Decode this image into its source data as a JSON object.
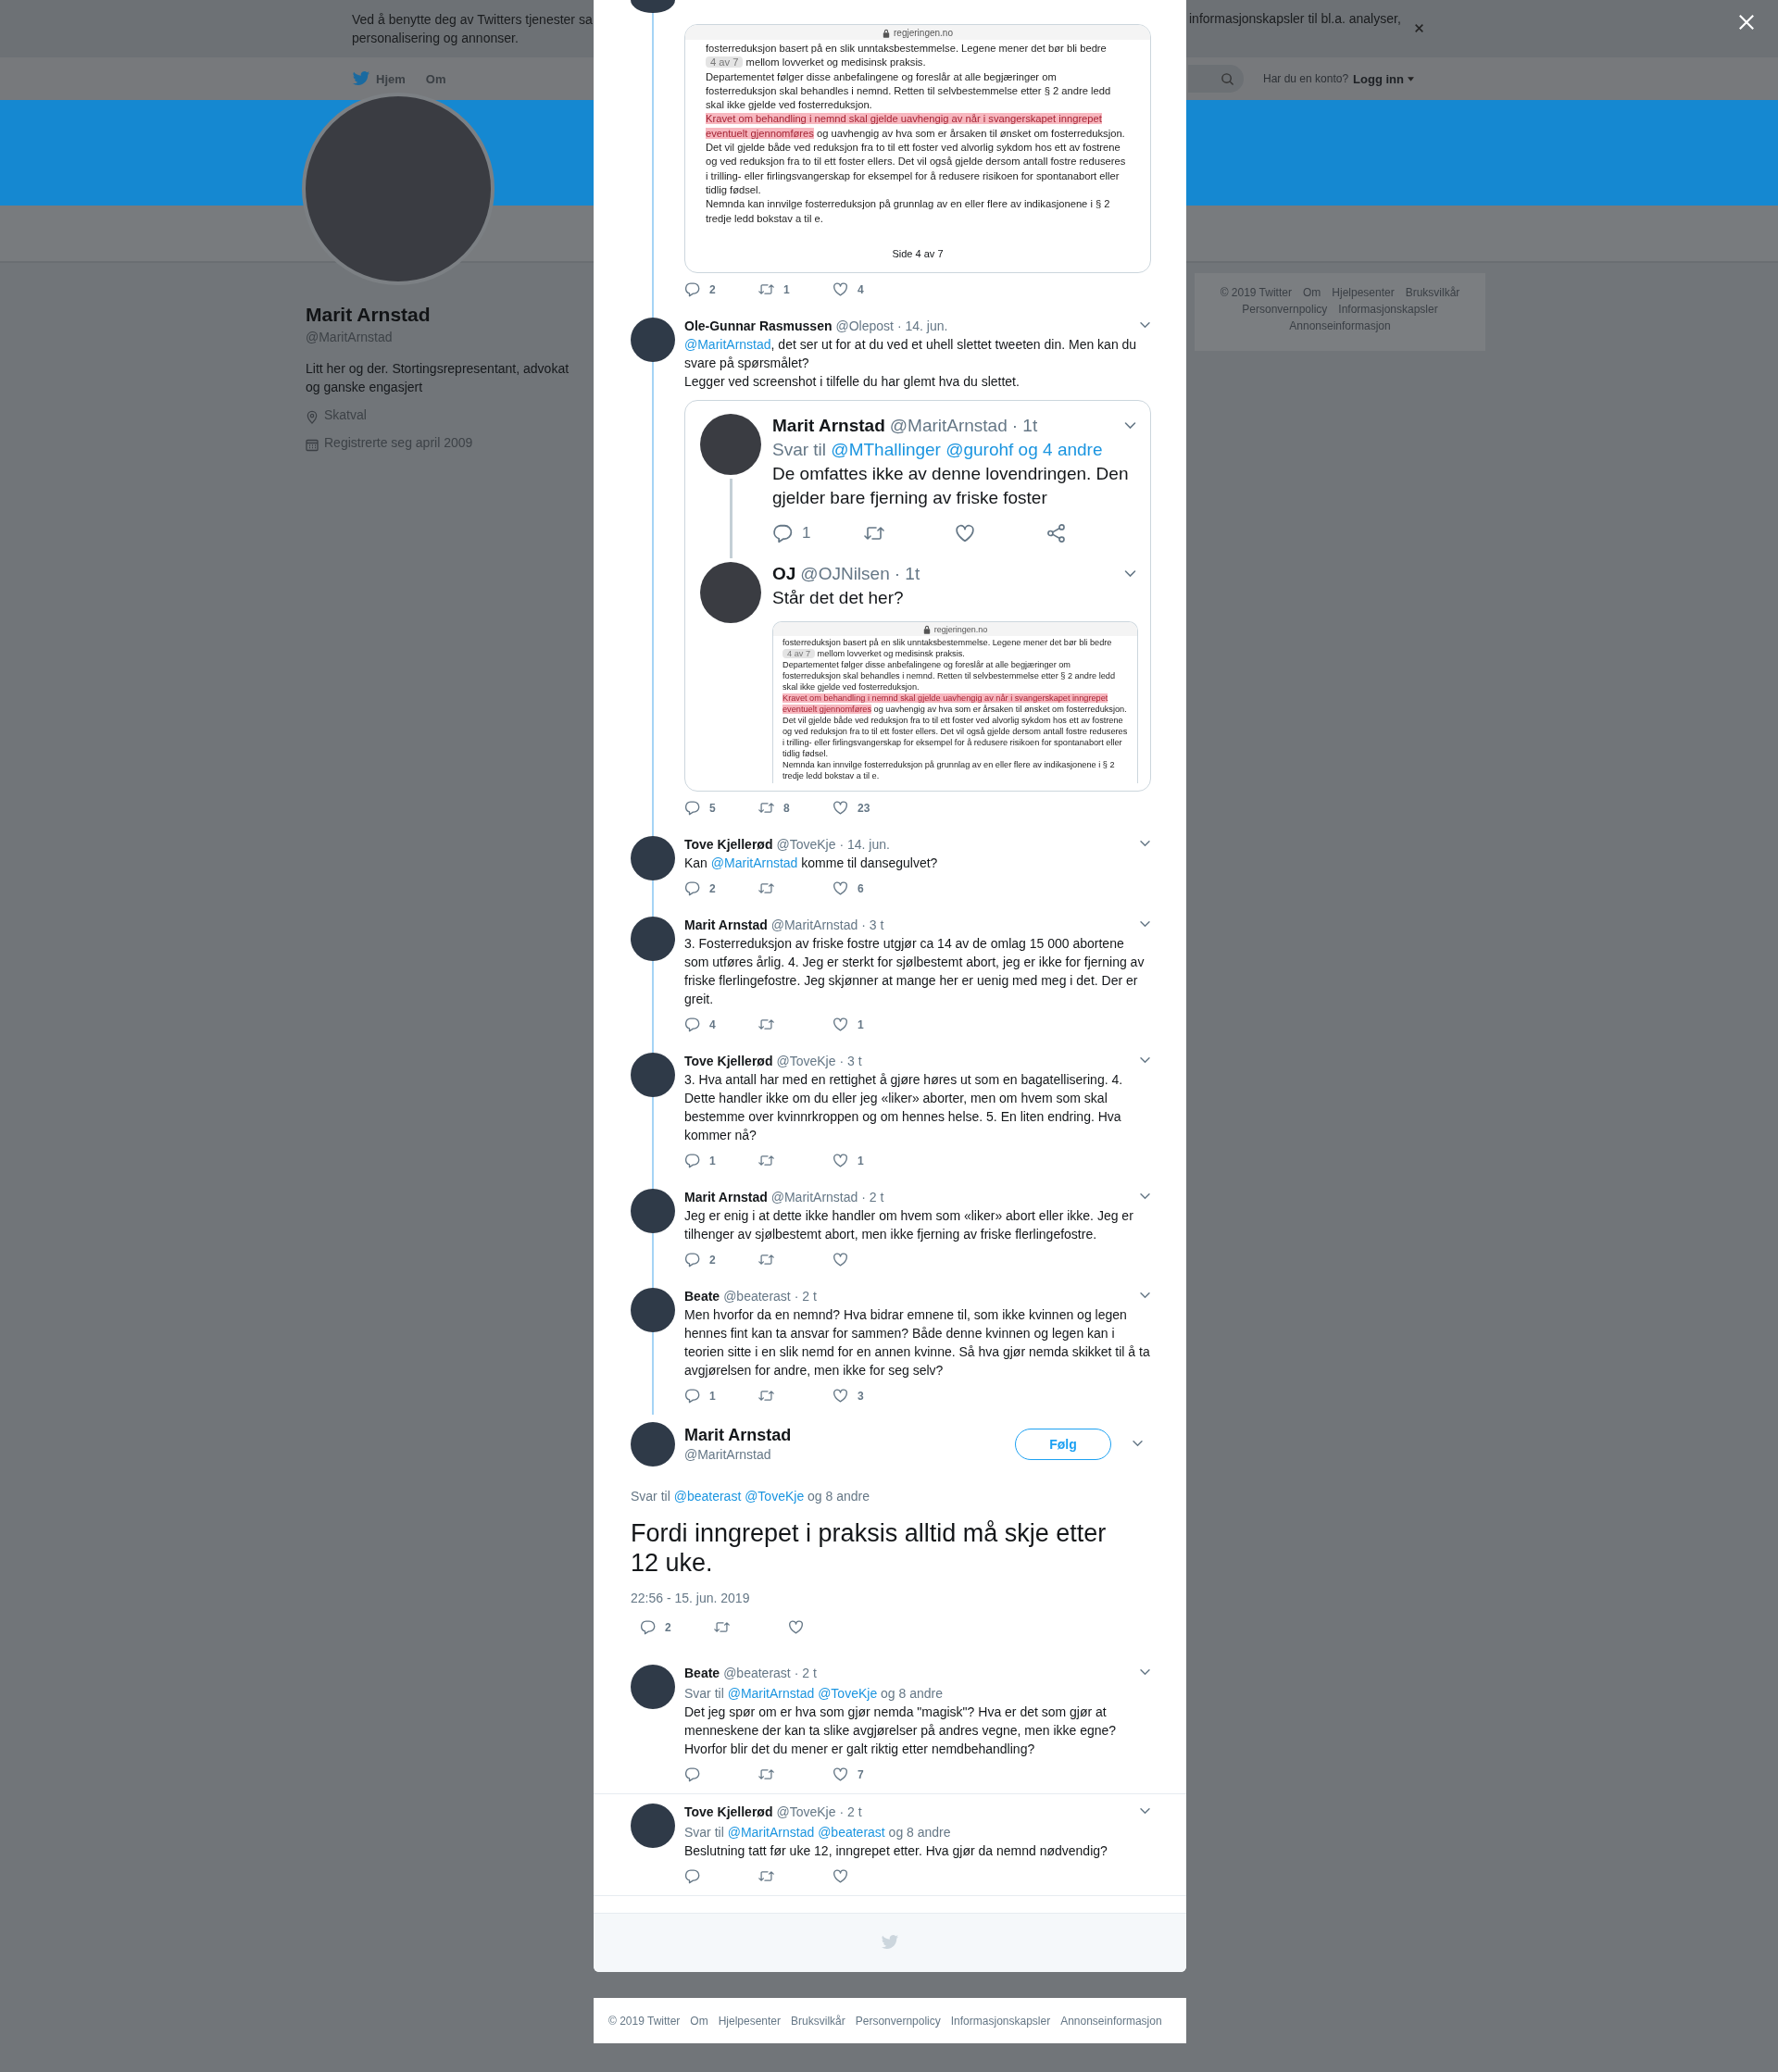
{
  "cookie_banner": {
    "text_left": "Ved å benytte deg av Twitters tjenester sa",
    "text_left_2": "personalisering og annonser.",
    "text_right": "informasjonskapsler til bl.a. analyser,"
  },
  "nav": {
    "items": [
      "Hjem",
      "Om"
    ],
    "account_prompt": "Har du en konto?",
    "login": "Logg inn"
  },
  "profile": {
    "name": "Marit Arnstad",
    "handle": "@MaritArnstad",
    "bio": "Litt her og der. Stortingsrepresentant, advokat og ganske engasjert",
    "location": "Skatval",
    "joined": "Registrerte seg april 2009"
  },
  "side_footer": [
    "© 2019 Twitter",
    "Om",
    "Hjelpesenter",
    "Bruksvilkår",
    "Personvernpolicy",
    "Informasjonskapsler",
    "Annonseinformasjon"
  ],
  "thread": [
    {
      "kind": "partial",
      "media": {
        "kind": "document",
        "site": "regjeringen.no",
        "footer": "Side 4 av 7",
        "paragraphs": [
          [
            {
              "kind": "plain",
              "text": "fosterreduksjon basert på en slik unntaksbestemmelse. Legene mener det bør bli bedre"
            }
          ],
          [
            {
              "kind": "badge",
              "text": "4 av 7"
            },
            {
              "kind": "plain",
              "text": " mellom lovverket og medisinsk praksis."
            }
          ],
          [
            {
              "kind": "plain",
              "text": "Departementet følger disse anbefalingene og foreslår at alle begjæringer om fosterreduksjon skal behandles i nemnd. Retten til selvbestemmelse etter § 2 andre ledd skal ikke gjelde ved fosterreduksjon."
            }
          ],
          [
            {
              "kind": "highlight",
              "text": "Kravet om behandling i nemnd skal gjelde uavhengig av når i svangerskapet inngrepet eventuelt gjennomføres"
            },
            {
              "kind": "plain",
              "text": " og uavhengig av hva som er årsaken til ønsket om fosterreduksjon. Det vil gjelde både ved reduksjon fra to til ett foster ved alvorlig sykdom hos ett av fostrene og ved reduksjon fra to til ett foster ellers. Det vil også gjelde dersom antall fostre reduseres i trilling- eller firlingsvangerskap for eksempel for å redusere risikoen for spontanabort eller tidlig fødsel."
            }
          ],
          [
            {
              "kind": "plain",
              "text": "Nemnda kan innvilge fosterreduksjon på grunnlag av en eller flere av indikasjonene i § 2 tredje ledd bokstav a til e."
            }
          ]
        ]
      },
      "actions": {
        "replies": "2",
        "retweets": "1",
        "likes": "4"
      }
    },
    {
      "kind": "full",
      "name": "Ole-Gunnar Rasmussen",
      "handle": "@Olepost",
      "time": "· 14. jun.",
      "text": [
        [
          {
            "kind": "mention",
            "text": "@MaritArnstad"
          },
          {
            "kind": "plain",
            "text": ", det ser ut for at du ved et uhell slettet tweeten din. Men kan du svare på spørsmålet?"
          }
        ],
        [
          {
            "kind": "plain",
            "text": "Legger ved screenshot i tilfelle du har glemt hva du slettet."
          }
        ]
      ],
      "media": {
        "kind": "tweet_screenshot",
        "tweets": [
          {
            "name": "Marit Arnstad",
            "handle": "@MaritArnstad",
            "time": "· 1t",
            "reply_to": [
              {
                "kind": "plain",
                "text": "Svar til "
              },
              {
                "kind": "mention",
                "text": "@MThallinger @gurohf og 4 andre"
              }
            ],
            "text": "De omfattes ikke av denne lovendringen. Den gjelder bare fjerning av friske foster",
            "actions": {
              "replies": "1"
            }
          },
          {
            "name": "OJ",
            "handle": "@OJNilsen",
            "time": "· 1t",
            "text": "Står det det her?",
            "media": {
              "kind": "document",
              "site": "regjeringen.no",
              "paragraphs": [
                [
                  {
                    "kind": "plain",
                    "text": "fosterreduksjon basert på en slik unntaksbestemmelse. Legene mener det bør bli bedre"
                  }
                ],
                [
                  {
                    "kind": "badge",
                    "text": "4 av 7"
                  },
                  {
                    "kind": "plain",
                    "text": " mellom lovverket og medisinsk praksis."
                  }
                ],
                [
                  {
                    "kind": "plain",
                    "text": "Departementet følger disse anbefalingene og foreslår at alle begjæringer om fosterreduksjon skal behandles i nemnd. Retten til selvbestemmelse etter § 2 andre ledd skal ikke gjelde ved fosterreduksjon."
                  }
                ],
                [
                  {
                    "kind": "highlight",
                    "text": "Kravet om behandling i nemnd skal gjelde uavhengig av når i svangerskapet inngrepet eventuelt gjennomføres"
                  },
                  {
                    "kind": "plain",
                    "text": " og uavhengig av hva som er årsaken til ønsket om fosterreduksjon. Det vil gjelde både ved reduksjon fra to til ett foster ved alvorlig sykdom hos ett av fostrene og ved reduksjon fra to til ett foster ellers. Det vil også gjelde dersom antall fostre reduseres i trilling- eller firlingsvangerskap for eksempel for å redusere risikoen for spontanabort eller tidlig fødsel."
                  }
                ],
                [
                  {
                    "kind": "plain",
                    "text": "Nemnda kan innvilge fosterreduksjon på grunnlag av en eller flere av indikasjonene i § 2 tredje ledd bokstav a til e."
                  }
                ]
              ]
            }
          }
        ]
      },
      "actions": {
        "replies": "5",
        "retweets": "8",
        "likes": "23"
      }
    },
    {
      "kind": "full",
      "name": "Tove Kjellerød",
      "handle": "@ToveKje",
      "time": "· 14. jun.",
      "text": [
        [
          {
            "kind": "plain",
            "text": "Kan "
          },
          {
            "kind": "mention",
            "text": "@MaritArnstad"
          },
          {
            "kind": "plain",
            "text": " komme til dansegulvet?"
          }
        ]
      ],
      "actions": {
        "replies": "2",
        "likes": "6"
      }
    },
    {
      "kind": "full",
      "name": "Marit Arnstad",
      "handle": "@MaritArnstad",
      "time": "· 3 t",
      "text": [
        [
          {
            "kind": "plain",
            "text": "3. Fosterreduksjon av friske fostre utgjør ca 14 av de omlag 15 000 abortene som utføres årlig. 4. Jeg er sterkt for sjølbestemt abort, jeg er ikke for fjerning av friske flerlingefostre. Jeg skjønner at mange her er uenig med meg i det. Der er greit."
          }
        ]
      ],
      "actions": {
        "replies": "4",
        "likes": "1"
      }
    },
    {
      "kind": "full",
      "name": "Tove Kjellerød",
      "handle": "@ToveKje",
      "time": "· 3 t",
      "text": [
        [
          {
            "kind": "plain",
            "text": "3. Hva antall har med en rettighet å gjøre høres ut som en bagatellisering. 4. Dette handler ikke om du eller jeg «liker» aborter, men om hvem som skal bestemme over kvinnrkroppen og om hennes helse. 5. En liten endring. Hva kommer nå?"
          }
        ]
      ],
      "actions": {
        "replies": "1",
        "likes": "1"
      }
    },
    {
      "kind": "full",
      "name": "Marit Arnstad",
      "handle": "@MaritArnstad",
      "time": "· 2 t",
      "text": [
        [
          {
            "kind": "plain",
            "text": "Jeg er enig i at dette ikke handler om hvem som «liker» abort eller ikke. Jeg er tilhenger av sjølbestemt abort, men ikke fjerning av friske flerlingefostre."
          }
        ]
      ],
      "actions": {
        "replies": "2"
      }
    },
    {
      "kind": "full",
      "name": "Beate",
      "handle": "@beaterast",
      "time": "· 2 t",
      "text": [
        [
          {
            "kind": "plain",
            "text": "Men hvorfor da en nemnd? Hva bidrar emnene til, som ikke kvinnen og legen hennes fint kan ta ansvar for sammen? Både denne kvinnen og legen kan i teorien sitte i en slik nemd for en annen kvinne. Så hva gjør nemda skikket til å ta avgjørelsen for andre, men ikke for seg selv?"
          }
        ]
      ],
      "actions": {
        "replies": "1",
        "likes": "3"
      }
    }
  ],
  "focused": {
    "name": "Marit Arnstad",
    "handle": "@MaritArnstad",
    "follow": "Følg",
    "reply_to": [
      {
        "kind": "plain",
        "text": "Svar til "
      },
      {
        "kind": "mention",
        "text": "@beaterast @ToveKje"
      },
      {
        "kind": "plain",
        "text": " og 8 andre"
      }
    ],
    "text": "Fordi inngrepet i praksis alltid må skje etter 12 uke.",
    "time": "22:56 - 15. jun. 2019",
    "actions": {
      "replies": "2"
    }
  },
  "replies": [
    {
      "kind": "full",
      "name": "Beate",
      "handle": "@beaterast",
      "time": "· 2 t",
      "reply_to": [
        {
          "kind": "plain",
          "text": "Svar til "
        },
        {
          "kind": "mention",
          "text": "@MaritArnstad @ToveKje"
        },
        {
          "kind": "plain",
          "text": " og 8 andre"
        }
      ],
      "text": [
        [
          {
            "kind": "plain",
            "text": "Det jeg spør om er hva som gjør nemda \"magisk\"? Hva er det som gjør at menneskene der kan ta slike avgjørelser på andres vegne, men ikke egne? Hvorfor blir det du mener er galt riktig etter nemdbehandling?"
          }
        ]
      ],
      "actions": {
        "likes": "7"
      }
    },
    {
      "kind": "full",
      "name": "Tove Kjellerød",
      "handle": "@ToveKje",
      "time": "· 2 t",
      "reply_to": [
        {
          "kind": "plain",
          "text": "Svar til "
        },
        {
          "kind": "mention",
          "text": "@MaritArnstad @beaterast"
        },
        {
          "kind": "plain",
          "text": " og 8 andre"
        }
      ],
      "text": [
        [
          {
            "kind": "plain",
            "text": "Beslutning tatt før uke 12, inngrepet etter. Hva gjør da nemnd nødvendig?"
          }
        ]
      ]
    }
  ],
  "footer": [
    "© 2019 Twitter",
    "Om",
    "Hjelpesenter",
    "Bruksvilkår",
    "Personvernpolicy",
    "Informasjonskapsler",
    "Annonseinformasjon"
  ]
}
